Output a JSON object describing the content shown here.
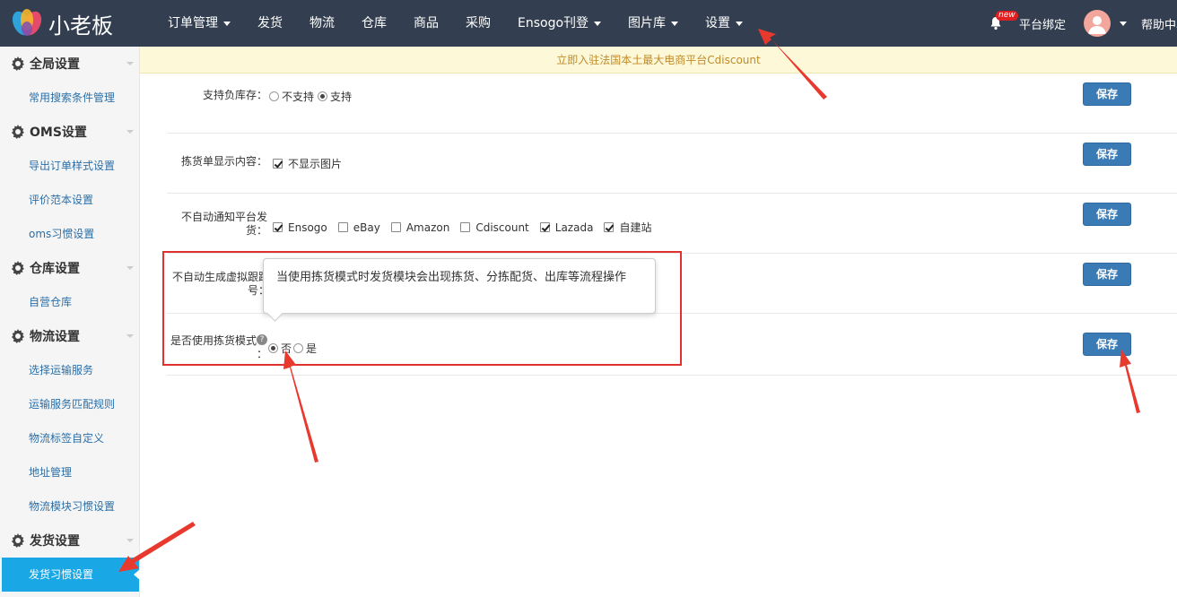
{
  "app": {
    "brand": "小老板"
  },
  "nav": {
    "items": [
      {
        "label": "订单管理",
        "dropdown": true
      },
      {
        "label": "发货",
        "dropdown": false
      },
      {
        "label": "物流",
        "dropdown": false
      },
      {
        "label": "仓库",
        "dropdown": false
      },
      {
        "label": "商品",
        "dropdown": false
      },
      {
        "label": "采购",
        "dropdown": false
      },
      {
        "label": "Ensogo刊登",
        "dropdown": true
      },
      {
        "label": "图片库",
        "dropdown": true
      },
      {
        "label": "设置",
        "dropdown": true
      }
    ],
    "new_badge": "new",
    "platform_bind": "平台绑定",
    "help": "帮助中心"
  },
  "sidebar": {
    "sections": [
      {
        "title": "全局设置",
        "items": [
          "常用搜索条件管理"
        ]
      },
      {
        "title": "OMS设置",
        "items": [
          "导出订单样式设置",
          "评价范本设置",
          "oms习惯设置"
        ]
      },
      {
        "title": "仓库设置",
        "items": [
          "自营仓库"
        ]
      },
      {
        "title": "物流设置",
        "items": [
          "选择运输服务",
          "运输服务匹配规则",
          "物流标签自定义",
          "地址管理",
          "物流模块习惯设置"
        ]
      },
      {
        "title": "发货设置",
        "items": [
          "发货习惯设置"
        ]
      }
    ],
    "active_item": "发货习惯设置"
  },
  "banner": {
    "text": "立即入驻法国本土最大电商平台Cdiscount"
  },
  "settings": {
    "save_label": "保存",
    "negative_stock": {
      "label": "支持负库存：",
      "options": [
        "不支持",
        "支持"
      ],
      "selected": "支持"
    },
    "picking_display": {
      "label": "拣货单显示内容：",
      "option": "不显示图片",
      "checked": true
    },
    "no_auto_notify": {
      "label_line1": "不自动通知平台发",
      "label_line2": "货：",
      "platforms": [
        {
          "name": "Ensogo",
          "checked": true
        },
        {
          "name": "eBay",
          "checked": false
        },
        {
          "name": "Amazon",
          "checked": false
        },
        {
          "name": "Cdiscount",
          "checked": false
        },
        {
          "name": "Lazada",
          "checked": true
        },
        {
          "name": "自建站",
          "checked": true
        }
      ]
    },
    "no_virtual_tracking": {
      "label_line1": "不自动生成虚拟跟踪",
      "label_line2": "号："
    },
    "use_picking_mode": {
      "label": "是否使用拣货模式",
      "colon": "：",
      "options": [
        "否",
        "是"
      ],
      "selected": "否"
    }
  },
  "tooltip": {
    "text": "当使用拣货模式时发货模块会出现拣货、分拣配货、出库等流程操作"
  },
  "colors": {
    "topbar": "#333f50",
    "active": "#1aa7e6",
    "save": "#3a7bb5",
    "annotation": "#e03030"
  }
}
